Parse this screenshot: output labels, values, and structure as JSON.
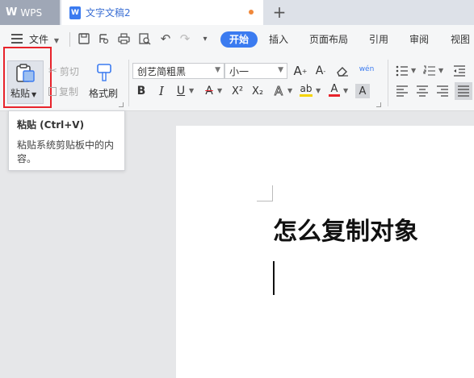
{
  "tabbar": {
    "app_label": "WPS",
    "doc_tab_label": "文字文稿2",
    "doc_icon_letter": "W",
    "new_tab_symbol": "+"
  },
  "menubar": {
    "file_label": "文件",
    "tabs": [
      "开始",
      "插入",
      "页面布局",
      "引用",
      "审阅",
      "视图"
    ],
    "active_tab": "开始"
  },
  "ribbon": {
    "paste_label": "粘贴",
    "cut_label": "剪切",
    "copy_label": "复制",
    "format_painter_label": "格式刷",
    "font_name": "创艺简粗黑",
    "font_size": "小一",
    "pinyin_glyph": "wén",
    "bold": "B",
    "italic": "I",
    "underline": "U",
    "strike": "A",
    "superscript": "X²",
    "subscript": "X₂",
    "text_effect": "A",
    "highlight": "ab",
    "font_color": "A",
    "char_shade": "A"
  },
  "tooltip": {
    "title": "粘贴 (Ctrl+V)",
    "description": "粘贴系统剪贴板中的内容。"
  },
  "document": {
    "heading": "怎么复制对象"
  },
  "colors": {
    "accent": "#3b7bf0",
    "highlight_box": "#e8232b",
    "font_color_bar": "#e8232b",
    "highlight_bar": "#f5d400"
  }
}
